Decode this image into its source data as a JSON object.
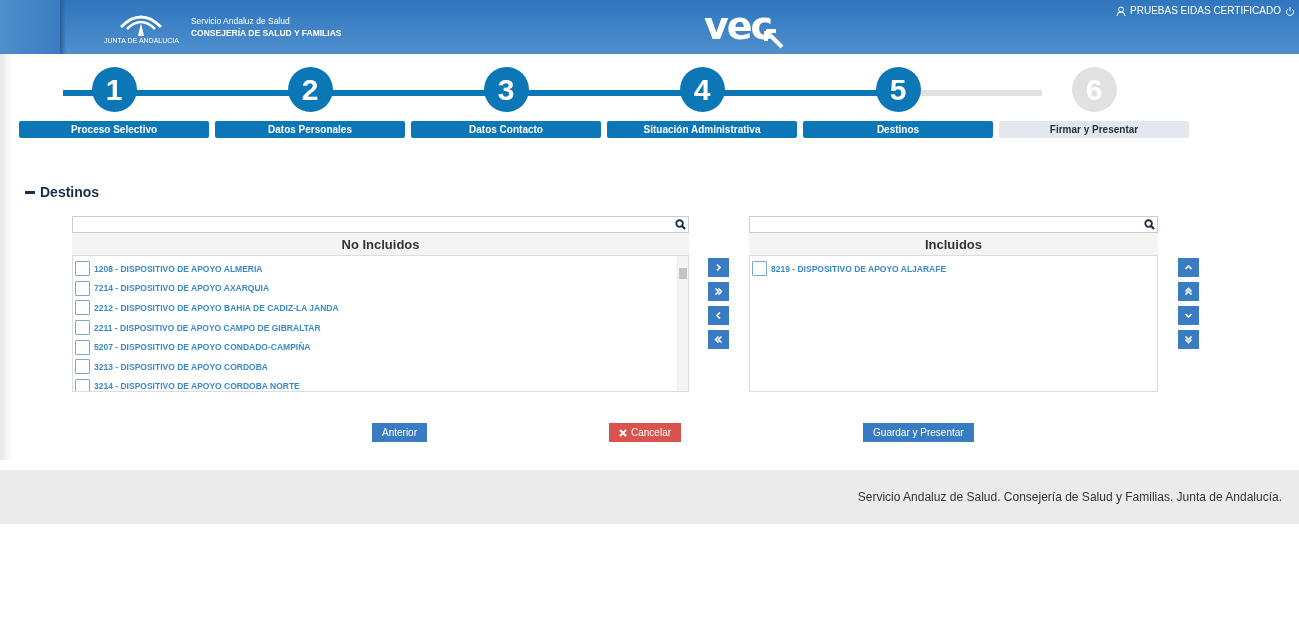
{
  "header": {
    "org_line1": "Servicio Andaluz de Salud",
    "org_line2": "CONSEJERÍA DE SALUD Y FAMILIAS",
    "emblem_caption": "JUNTA DE ANDALUCIA",
    "app_logo": "vec",
    "user": "PRUEBAS EIDAS CERTIFICADO"
  },
  "steps": [
    {
      "number": "1",
      "label": "Proceso Selectivo",
      "active": true
    },
    {
      "number": "2",
      "label": "Datos Personales",
      "active": true
    },
    {
      "number": "3",
      "label": "Datos Contacto",
      "active": true
    },
    {
      "number": "4",
      "label": "Situación Administrativa",
      "active": true
    },
    {
      "number": "5",
      "label": "Destinos",
      "active": true
    },
    {
      "number": "6",
      "label": "Firmar y Presentar",
      "active": false
    }
  ],
  "section": {
    "title": "Destinos",
    "expanded": true
  },
  "excluded": {
    "title": "No Incluidos",
    "items": [
      {
        "label": "1208 - DISPOSITIVO DE APOYO ALMERIA",
        "checked": false
      },
      {
        "label": "7214 - DISPOSITIVO DE APOYO AXARQUIA",
        "checked": false
      },
      {
        "label": "2212 - DISPOSITIVO DE APOYO BAHIA DE CADIZ-LA JANDA",
        "checked": false
      },
      {
        "label": "2211 - DISPOSITIVO DE APOYO CAMPO DE GIBRALTAR",
        "checked": false
      },
      {
        "label": "5207 - DISPOSITIVO DE APOYO CONDADO-CAMPIÑA",
        "checked": false
      },
      {
        "label": "3213 - DISPOSITIVO DE APOYO CORDOBA",
        "checked": false
      },
      {
        "label": "3214 - DISPOSITIVO DE APOYO CORDOBA NORTE",
        "checked": false
      }
    ]
  },
  "included": {
    "title": "Incluidos",
    "items": [
      {
        "label": "8219 - DISPOSITIVO DE APOYO ALJARAFE",
        "checked": false
      }
    ]
  },
  "buttons": [
    {
      "label": "Anterior",
      "kind": "primary"
    },
    {
      "label": "Cancelar",
      "kind": "danger"
    },
    {
      "label": "Guardar y Presentar",
      "kind": "primary"
    }
  ],
  "footer": "Servicio Andaluz de Salud. Consejería de Salud y Familias. Junta de Andalucía."
}
